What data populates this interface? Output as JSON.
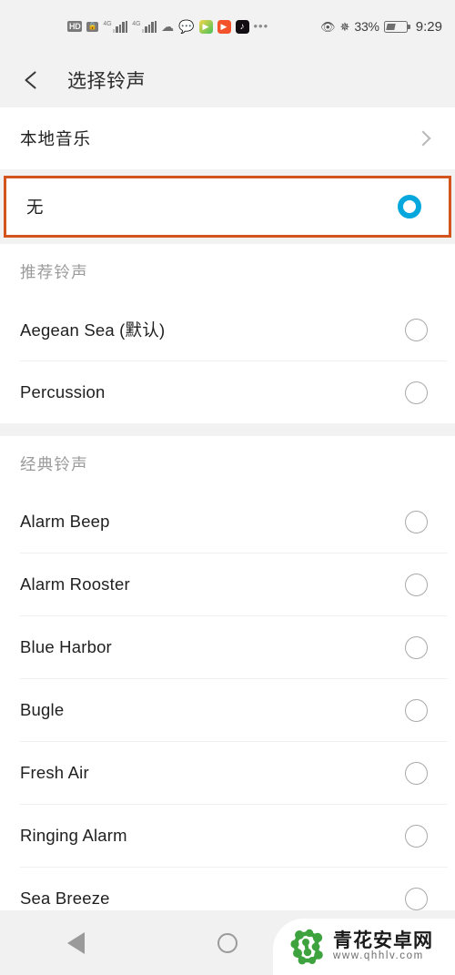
{
  "statusbar": {
    "hd_label": "HD",
    "sim_lock_icon": "sim-lock-icon",
    "network_label_1": "4G",
    "network_label_2": "4G",
    "app_icons": [
      "cloud-alert-icon",
      "chat-bubble-icon",
      "play-store-icon",
      "video-player-icon",
      "tiktok-icon"
    ],
    "overflow": "•••",
    "eye_icon": "eye-comfort-icon",
    "bluetooth_icon": "bluetooth-icon",
    "battery_percent": "33%",
    "time": "9:29"
  },
  "appbar": {
    "back_icon": "back-arrow-icon",
    "title": "选择铃声"
  },
  "local_music": {
    "label": "本地音乐",
    "chevron_icon": "chevron-right-icon"
  },
  "selected_row": {
    "label": "无",
    "radio_icon": "radio-checked-icon",
    "selected": true
  },
  "sections": [
    {
      "title": "推荐铃声",
      "items": [
        {
          "label": "Aegean Sea (默认)",
          "selected": false
        },
        {
          "label": "Percussion",
          "selected": false
        }
      ]
    },
    {
      "title": "经典铃声",
      "items": [
        {
          "label": "Alarm Beep",
          "selected": false
        },
        {
          "label": "Alarm Rooster",
          "selected": false
        },
        {
          "label": "Blue Harbor",
          "selected": false
        },
        {
          "label": "Bugle",
          "selected": false
        },
        {
          "label": "Fresh Air",
          "selected": false
        },
        {
          "label": "Ringing Alarm",
          "selected": false
        },
        {
          "label": "Sea Breeze",
          "selected": false
        }
      ]
    }
  ],
  "navbar": {
    "back_icon": "nav-back-icon",
    "home_icon": "nav-home-icon",
    "recent_icon": "nav-recent-icon"
  },
  "watermark": {
    "logo_icon": "qhhlv-logo-icon",
    "site_name": "青花安卓网",
    "url": "www.qhhlv.com"
  },
  "colors": {
    "accent_selected": "#06a7dd",
    "highlight_border": "#d4541d",
    "header_bg": "#f2f2f2",
    "section_title": "#9b9b9b",
    "watermark_green": "#3ea33e"
  }
}
